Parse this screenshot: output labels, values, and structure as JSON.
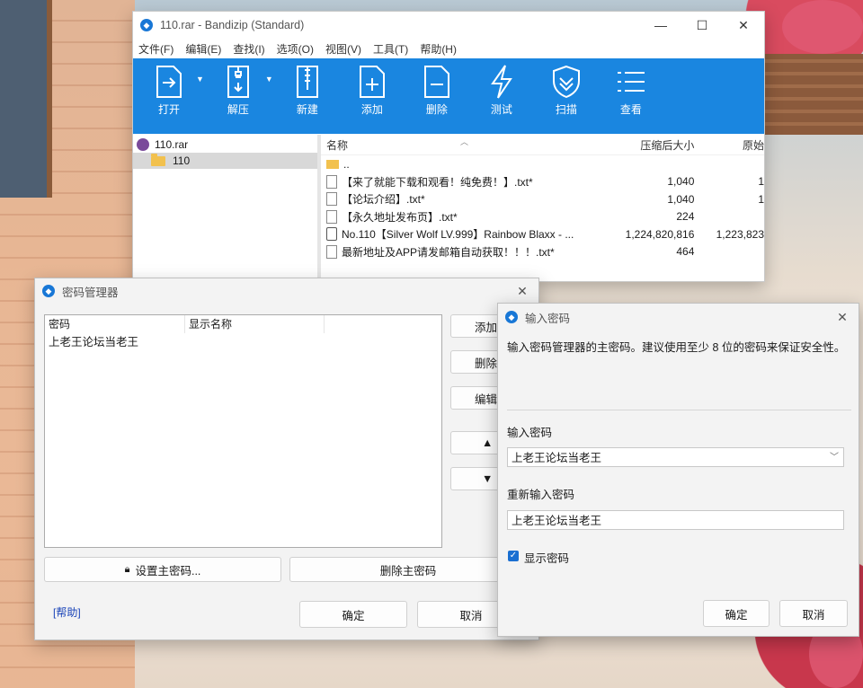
{
  "bandizip": {
    "title": "110.rar - Bandizip (Standard)",
    "window_controls": {
      "minimize": "—",
      "maximize": "☐",
      "close": "✕"
    },
    "menu": [
      "文件(F)",
      "编辑(E)",
      "查找(I)",
      "选项(O)",
      "视图(V)",
      "工具(T)",
      "帮助(H)"
    ],
    "toolbar": {
      "open": "打开",
      "extract": "解压",
      "new": "新建",
      "add": "添加",
      "delete": "删除",
      "test": "测试",
      "scan": "扫描",
      "view": "查看"
    },
    "tree": {
      "root": "110.rar",
      "folder": "110"
    },
    "columns": {
      "name": "名称",
      "packed": "压缩后大小",
      "original": "原始"
    },
    "files": [
      {
        "name": "..",
        "packed": "",
        "original": ""
      },
      {
        "name": "【来了就能下载和观看！纯免费！】.txt*",
        "packed": "1,040",
        "original": "1"
      },
      {
        "name": "【论坛介绍】.txt*",
        "packed": "1,040",
        "original": "1"
      },
      {
        "name": "【永久地址发布页】.txt*",
        "packed": "224",
        "original": ""
      },
      {
        "name": "No.110【Silver Wolf LV.999】Rainbow Blaxx - ...",
        "packed": "1,224,820,816",
        "original": "1,223,823"
      },
      {
        "name": "最新地址及APP请发邮箱自动获取！！！.txt*",
        "packed": "464",
        "original": ""
      }
    ]
  },
  "password_manager": {
    "title": "密码管理器",
    "columns": {
      "password": "密码",
      "display_name": "显示名称"
    },
    "rows": [
      {
        "password": "上老王论坛当老王",
        "display_name": ""
      }
    ],
    "side_buttons": {
      "add": "添加",
      "delete": "删除",
      "edit": "编辑",
      "up": "▲",
      "down": "▼"
    },
    "set_master": "设置主密码...",
    "delete_master": "删除主密码",
    "help": "[帮助]",
    "ok": "确定",
    "cancel": "取消"
  },
  "enter_password": {
    "title": "输入密码",
    "description": "输入密码管理器的主密码。建议使用至少 8 位的密码来保证安全性。",
    "password_label": "输入密码",
    "password_value": "上老王论坛当老王",
    "confirm_label": "重新输入密码",
    "confirm_value": "上老王论坛当老王",
    "show_password": "显示密码",
    "show_password_checked": true,
    "ok": "确定",
    "cancel": "取消"
  }
}
